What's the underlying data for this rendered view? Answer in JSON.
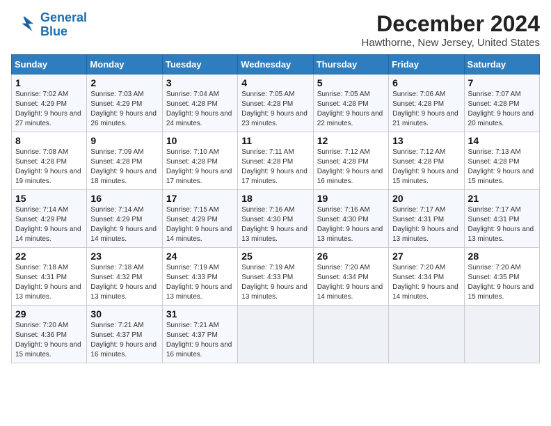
{
  "header": {
    "logo_line1": "General",
    "logo_line2": "Blue",
    "title": "December 2024",
    "subtitle": "Hawthorne, New Jersey, United States"
  },
  "calendar": {
    "days_of_week": [
      "Sunday",
      "Monday",
      "Tuesday",
      "Wednesday",
      "Thursday",
      "Friday",
      "Saturday"
    ],
    "weeks": [
      [
        {
          "day": "",
          "empty": true
        },
        {
          "day": "",
          "empty": true
        },
        {
          "day": "",
          "empty": true
        },
        {
          "day": "",
          "empty": true
        },
        {
          "day": "",
          "empty": true
        },
        {
          "day": "",
          "empty": true
        },
        {
          "day": "",
          "empty": true
        }
      ],
      [
        {
          "day": "1",
          "sunrise": "7:02 AM",
          "sunset": "4:29 PM",
          "daylight": "9 hours and 27 minutes."
        },
        {
          "day": "2",
          "sunrise": "7:03 AM",
          "sunset": "4:29 PM",
          "daylight": "9 hours and 26 minutes."
        },
        {
          "day": "3",
          "sunrise": "7:04 AM",
          "sunset": "4:28 PM",
          "daylight": "9 hours and 24 minutes."
        },
        {
          "day": "4",
          "sunrise": "7:05 AM",
          "sunset": "4:28 PM",
          "daylight": "9 hours and 23 minutes."
        },
        {
          "day": "5",
          "sunrise": "7:05 AM",
          "sunset": "4:28 PM",
          "daylight": "9 hours and 22 minutes."
        },
        {
          "day": "6",
          "sunrise": "7:06 AM",
          "sunset": "4:28 PM",
          "daylight": "9 hours and 21 minutes."
        },
        {
          "day": "7",
          "sunrise": "7:07 AM",
          "sunset": "4:28 PM",
          "daylight": "9 hours and 20 minutes."
        }
      ],
      [
        {
          "day": "8",
          "sunrise": "7:08 AM",
          "sunset": "4:28 PM",
          "daylight": "9 hours and 19 minutes."
        },
        {
          "day": "9",
          "sunrise": "7:09 AM",
          "sunset": "4:28 PM",
          "daylight": "9 hours and 18 minutes."
        },
        {
          "day": "10",
          "sunrise": "7:10 AM",
          "sunset": "4:28 PM",
          "daylight": "9 hours and 17 minutes."
        },
        {
          "day": "11",
          "sunrise": "7:11 AM",
          "sunset": "4:28 PM",
          "daylight": "9 hours and 17 minutes."
        },
        {
          "day": "12",
          "sunrise": "7:12 AM",
          "sunset": "4:28 PM",
          "daylight": "9 hours and 16 minutes."
        },
        {
          "day": "13",
          "sunrise": "7:12 AM",
          "sunset": "4:28 PM",
          "daylight": "9 hours and 15 minutes."
        },
        {
          "day": "14",
          "sunrise": "7:13 AM",
          "sunset": "4:28 PM",
          "daylight": "9 hours and 15 minutes."
        }
      ],
      [
        {
          "day": "15",
          "sunrise": "7:14 AM",
          "sunset": "4:29 PM",
          "daylight": "9 hours and 14 minutes."
        },
        {
          "day": "16",
          "sunrise": "7:14 AM",
          "sunset": "4:29 PM",
          "daylight": "9 hours and 14 minutes."
        },
        {
          "day": "17",
          "sunrise": "7:15 AM",
          "sunset": "4:29 PM",
          "daylight": "9 hours and 14 minutes."
        },
        {
          "day": "18",
          "sunrise": "7:16 AM",
          "sunset": "4:30 PM",
          "daylight": "9 hours and 13 minutes."
        },
        {
          "day": "19",
          "sunrise": "7:16 AM",
          "sunset": "4:30 PM",
          "daylight": "9 hours and 13 minutes."
        },
        {
          "day": "20",
          "sunrise": "7:17 AM",
          "sunset": "4:31 PM",
          "daylight": "9 hours and 13 minutes."
        },
        {
          "day": "21",
          "sunrise": "7:17 AM",
          "sunset": "4:31 PM",
          "daylight": "9 hours and 13 minutes."
        }
      ],
      [
        {
          "day": "22",
          "sunrise": "7:18 AM",
          "sunset": "4:31 PM",
          "daylight": "9 hours and 13 minutes."
        },
        {
          "day": "23",
          "sunrise": "7:18 AM",
          "sunset": "4:32 PM",
          "daylight": "9 hours and 13 minutes."
        },
        {
          "day": "24",
          "sunrise": "7:19 AM",
          "sunset": "4:33 PM",
          "daylight": "9 hours and 13 minutes."
        },
        {
          "day": "25",
          "sunrise": "7:19 AM",
          "sunset": "4:33 PM",
          "daylight": "9 hours and 13 minutes."
        },
        {
          "day": "26",
          "sunrise": "7:20 AM",
          "sunset": "4:34 PM",
          "daylight": "9 hours and 14 minutes."
        },
        {
          "day": "27",
          "sunrise": "7:20 AM",
          "sunset": "4:34 PM",
          "daylight": "9 hours and 14 minutes."
        },
        {
          "day": "28",
          "sunrise": "7:20 AM",
          "sunset": "4:35 PM",
          "daylight": "9 hours and 15 minutes."
        }
      ],
      [
        {
          "day": "29",
          "sunrise": "7:20 AM",
          "sunset": "4:36 PM",
          "daylight": "9 hours and 15 minutes."
        },
        {
          "day": "30",
          "sunrise": "7:21 AM",
          "sunset": "4:37 PM",
          "daylight": "9 hours and 16 minutes."
        },
        {
          "day": "31",
          "sunrise": "7:21 AM",
          "sunset": "4:37 PM",
          "daylight": "9 hours and 16 minutes."
        },
        {
          "day": "",
          "empty": true
        },
        {
          "day": "",
          "empty": true
        },
        {
          "day": "",
          "empty": true
        },
        {
          "day": "",
          "empty": true
        }
      ]
    ],
    "labels": {
      "sunrise": "Sunrise:",
      "sunset": "Sunset:",
      "daylight": "Daylight:"
    }
  }
}
